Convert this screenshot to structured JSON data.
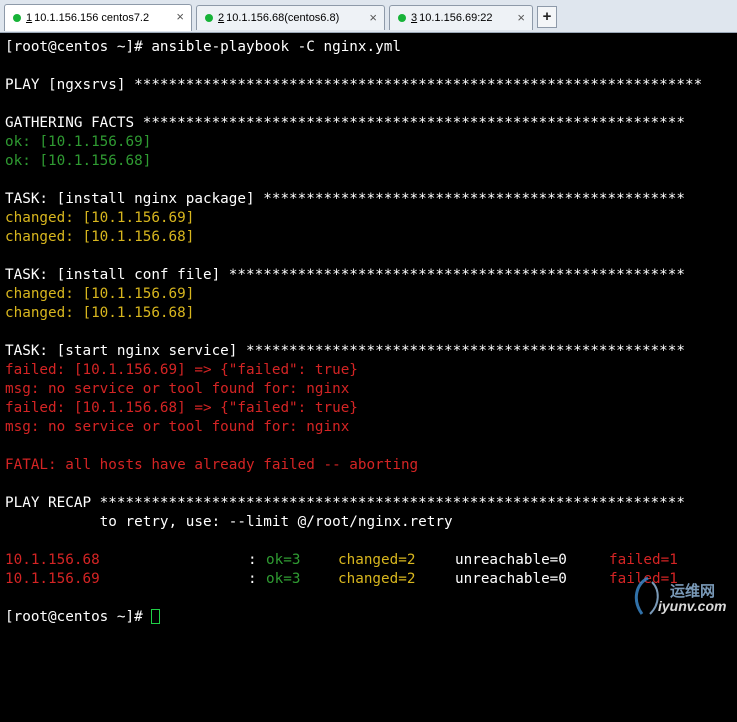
{
  "tabs": [
    {
      "number": "1",
      "title": "10.1.156.156 centos7.2",
      "close": "×"
    },
    {
      "number": "2",
      "title": "10.1.156.68(centos6.8)",
      "close": "×"
    },
    {
      "number": "3",
      "title": "10.1.156.69:22",
      "close": "×"
    }
  ],
  "new_tab": "+",
  "terminal": {
    "prompt_command": "[root@centos ~]# ansible-playbook -C nginx.yml",
    "play": "PLAY [ngxsrvs] ******************************************************************",
    "gathering": "GATHERING FACTS ***************************************************************",
    "gather_ok_1": "ok: [10.1.156.69]",
    "gather_ok_2": "ok: [10.1.156.68]",
    "task1": "TASK: [install nginx package] *************************************************",
    "task1_r1": "changed: [10.1.156.69]",
    "task1_r2": "changed: [10.1.156.68]",
    "task2": "TASK: [install conf file] *****************************************************",
    "task2_r1": "changed: [10.1.156.69]",
    "task2_r2": "changed: [10.1.156.68]",
    "task3": "TASK: [start nginx service] ***************************************************",
    "task3_r1": "failed: [10.1.156.69] => {\"failed\": true}",
    "task3_m1": "msg: no service or tool found for: nginx",
    "task3_r2": "failed: [10.1.156.68] => {\"failed\": true}",
    "task3_m2": "msg: no service or tool found for: nginx",
    "fatal": "FATAL: all hosts have already failed -- aborting",
    "recap": "PLAY RECAP ********************************************************************",
    "retry": "           to retry, use: --limit @/root/nginx.retry",
    "recap_rows": [
      {
        "host": "10.1.156.68",
        "colon": ":",
        "ok": "ok=3",
        "changed": "changed=2",
        "unreachable": "unreachable=0",
        "failed": "failed=1"
      },
      {
        "host": "10.1.156.69",
        "colon": ":",
        "ok": "ok=3",
        "changed": "changed=2",
        "unreachable": "unreachable=0",
        "failed": "failed=1"
      }
    ],
    "final_prompt": "[root@centos ~]# "
  },
  "watermark": {
    "cn": "运维网",
    "en": "iyunv.com"
  },
  "colors": {
    "ok": "#2f9b32",
    "changed": "#d8b61e",
    "failed": "#d42424",
    "text": "#ffffff",
    "background": "#000000",
    "tab_dot": "#17b338"
  }
}
